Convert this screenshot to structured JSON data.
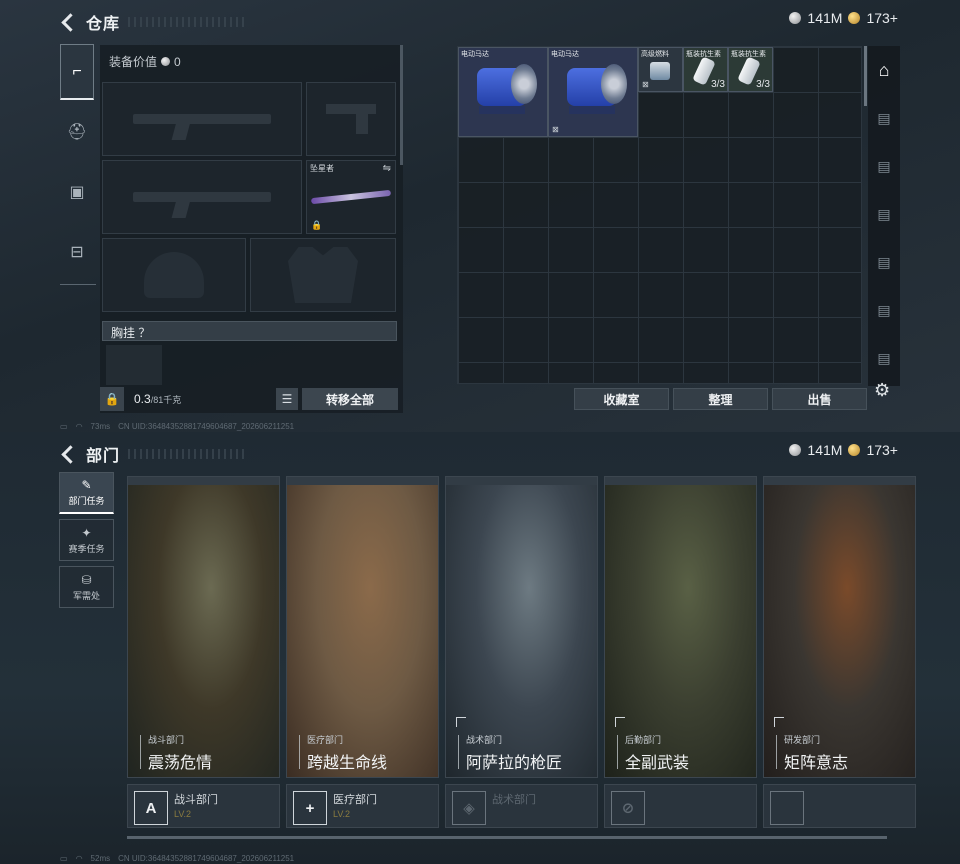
{
  "top": {
    "title": "仓库",
    "currency": {
      "silver": "141M",
      "gold": "173+"
    },
    "equip_value_label": "装备价值",
    "equip_value": "0",
    "melee_name": "坠星者",
    "swap_glyph": "⇋",
    "lock_glyph": "🔒",
    "chest_label": "胸挂 ？",
    "weight": "0.3",
    "weight_unit": "/81千克",
    "list_glyph": "☰",
    "transfer_all": "转移全部",
    "items": [
      {
        "name": "电动马达",
        "count": "",
        "icon": "motor"
      },
      {
        "name": "电动马达",
        "count": "",
        "icon": "motor"
      },
      {
        "name": "高级燃料",
        "count": "",
        "icon": "fuel-can"
      },
      {
        "name": "瓶装抗生素",
        "count": "3/3",
        "icon": "antibiotic-bottle"
      },
      {
        "name": "瓶装抗生素",
        "count": "3/3",
        "icon": "antibiotic-bottle"
      }
    ],
    "actions": {
      "collection": "收藏室",
      "sort": "整理",
      "sell": "出售"
    },
    "gear_glyph": "⚙",
    "footer": {
      "ping": "73ms",
      "uid": "CN UID:3648435288174960468​7_202606211251"
    }
  },
  "bottom": {
    "title": "部门",
    "currency": {
      "silver": "141M",
      "gold": "173+"
    },
    "nav": [
      {
        "label": "部门任务",
        "glyph": "✎",
        "active": true
      },
      {
        "label": "赛季任务",
        "glyph": "✦",
        "active": false
      },
      {
        "label": "军需处",
        "glyph": "⛁",
        "active": false
      }
    ],
    "cards": [
      {
        "sub": "战斗部门",
        "name": "震荡危情",
        "colors": [
          "#3e3828",
          "#6b6a52",
          "#1f2420"
        ]
      },
      {
        "sub": "医疗部门",
        "name": "跨越生命线",
        "colors": [
          "#6e5a44",
          "#8b6a4a",
          "#3a2c22"
        ]
      },
      {
        "sub": "战术部门",
        "name": "阿萨拉的枪匠",
        "colors": [
          "#3c4650",
          "#6d7a82",
          "#1e262c"
        ]
      },
      {
        "sub": "后勤部门",
        "name": "全副武装",
        "colors": [
          "#3b3f30",
          "#596045",
          "#1d211a"
        ]
      },
      {
        "sub": "研发部门",
        "name": "矩阵意志",
        "colors": [
          "#3a3631",
          "#7a4a2a",
          "#221e1c"
        ]
      }
    ],
    "badges": [
      {
        "name": "战斗部门",
        "level": "LV.2",
        "glyph": "A",
        "dim": false
      },
      {
        "name": "医疗部门",
        "level": "LV.2",
        "glyph": "+",
        "dim": false
      },
      {
        "name": "战术部门",
        "level": "",
        "glyph": "◈",
        "dim": true
      },
      {
        "name": "",
        "level": "",
        "glyph": "⊘",
        "dim": true
      },
      {
        "name": "",
        "level": "",
        "glyph": "",
        "dim": true
      }
    ],
    "footer": {
      "ping": "52ms",
      "uid": "CN UID:3648435288174960468​7_202606211251"
    }
  }
}
